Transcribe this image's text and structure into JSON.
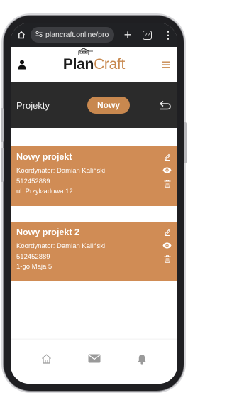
{
  "browser": {
    "url": "plancraft.online/proje",
    "tab_count": "22",
    "home_icon": "home-icon",
    "site_settings_icon": "tune-icon",
    "new_tab_icon": "plus-icon",
    "menu_icon": "kebab-menu-icon"
  },
  "header": {
    "logo_plan": "Plan",
    "logo_craft": "Craft",
    "user_icon": "person-icon",
    "menu_icon": "hamburger-icon"
  },
  "toolbar": {
    "title": "Projekty",
    "new_label": "Nowy",
    "back_icon": "return-arrow-icon"
  },
  "projects": [
    {
      "name": "Nowy projekt",
      "coordinator": "Koordynator: Damian Kaliński",
      "phone": "512452889",
      "address": "ul. Przykładowa 12"
    },
    {
      "name": "Nowy projekt 2",
      "coordinator": "Koordynator: Damian Kaliński",
      "phone": "512452889",
      "address": "1-go Maja 5"
    }
  ],
  "bottom_nav": {
    "items": [
      "home-icon",
      "mail-icon",
      "bell-icon"
    ]
  },
  "colors": {
    "accent": "#d08c55",
    "button": "#c8884f",
    "toolbar": "#2b2b2b",
    "browser_bar": "#202124"
  }
}
